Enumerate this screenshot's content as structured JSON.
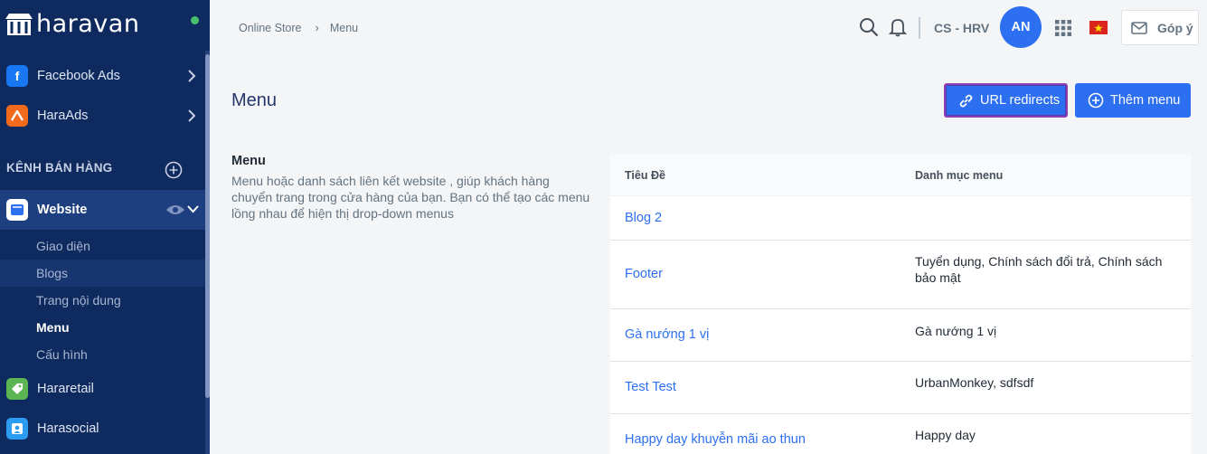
{
  "brand": {
    "name": "haravan"
  },
  "sidebar": {
    "apps": [
      {
        "label": "Facebook Ads",
        "icon": "facebook-icon",
        "color": "#1877f2"
      },
      {
        "label": "HaraAds",
        "icon": "haraads-icon",
        "color": "#f26b1d"
      }
    ],
    "section_title": "KÊNH BÁN HÀNG",
    "website": {
      "label": "Website",
      "icon": "store-icon"
    },
    "website_sub": [
      "Giao diện",
      "Blogs",
      "Trang nội dung",
      "Menu",
      "Cấu hình"
    ],
    "channels": [
      {
        "label": "Hararetail",
        "icon": "tag-icon",
        "color": "#5ab552"
      },
      {
        "label": "Harasocial",
        "icon": "social-icon",
        "color": "#2c9cf0"
      }
    ]
  },
  "topbar": {
    "breadcrumb": [
      "Online Store",
      "Menu"
    ],
    "store_name": "CS - HRV",
    "avatar_initials": "AN",
    "feedback_label": "Góp ý"
  },
  "page": {
    "title": "Menu",
    "redirects_label": "URL redirects",
    "add_label": "Thêm menu",
    "desc_title": "Menu",
    "desc_text": "Menu hoặc danh sách liên kết website , giúp khách hàng chuyển trang trong cửa hàng của bạn. Bạn có thể tạo các menu lồng nhau để hiện thị drop-down menus"
  },
  "table": {
    "headers": [
      "Tiêu Đề",
      "Danh mục menu"
    ],
    "rows": [
      {
        "title": "Blog 2",
        "menu": ""
      },
      {
        "title": "Footer",
        "menu": "Tuyển dụng, Chính sách đổi trả, Chính sách bảo mật"
      },
      {
        "title": "Gà nướng 1 vị",
        "menu": "Gà nướng 1 vị"
      },
      {
        "title": "Test Test",
        "menu": "UrbanMonkey, sdfsdf"
      },
      {
        "title": "Happy day khuyễn mãi ao thun",
        "menu": "Happy day"
      }
    ]
  },
  "colors": {
    "sidebar": "#0f2a5e",
    "accent": "#2c6ff0",
    "online": "#47c16d"
  }
}
